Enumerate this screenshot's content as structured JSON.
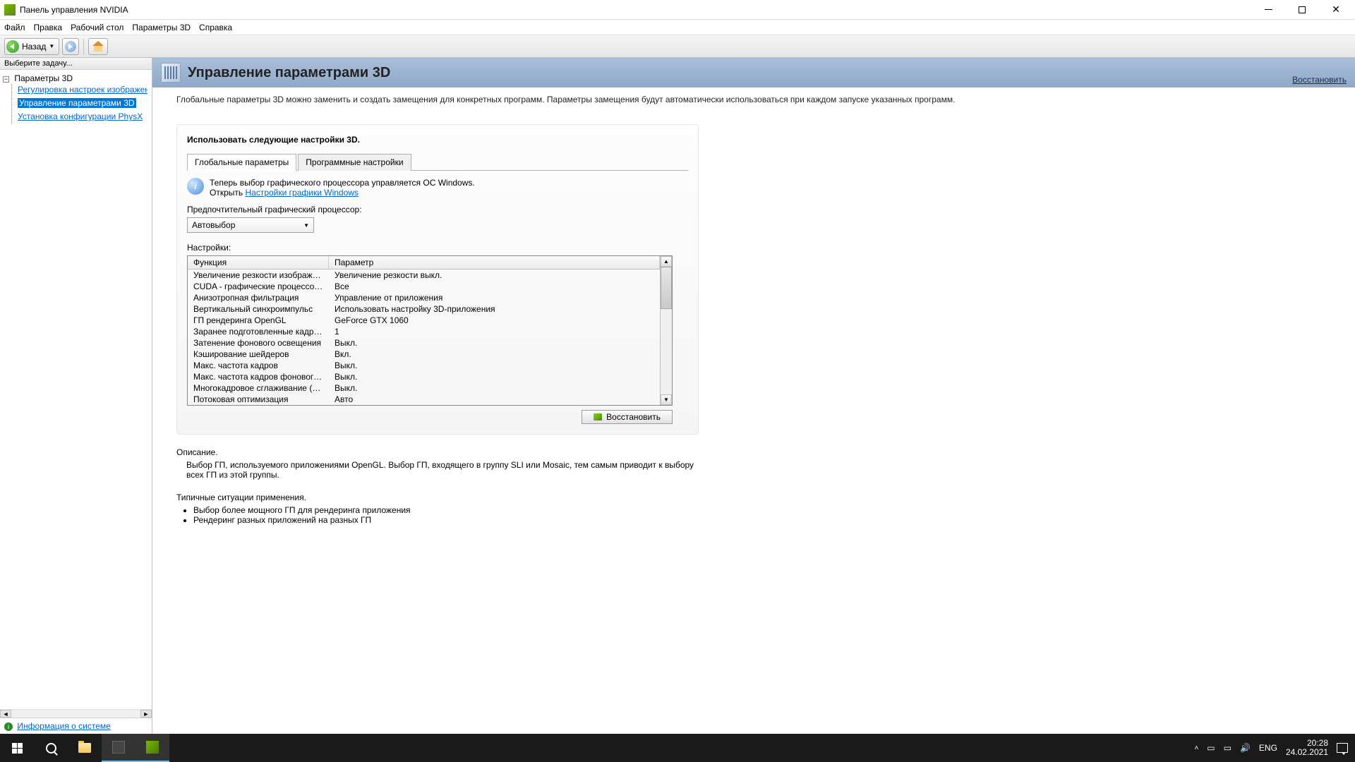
{
  "titlebar": {
    "title": "Панель управления NVIDIA"
  },
  "menu": {
    "file": "Файл",
    "edit": "Правка",
    "desktop": "Рабочий стол",
    "params3d": "Параметры 3D",
    "help": "Справка"
  },
  "nav": {
    "back": "Назад"
  },
  "sidebar": {
    "header": "Выберите задачу...",
    "root": "Параметры 3D",
    "items": [
      "Регулировка настроек изображения с п",
      "Управление параметрами 3D",
      "Установка конфигурации PhysX"
    ],
    "sysinfo": "Информация о системе"
  },
  "page": {
    "title": "Управление параметрами 3D",
    "restore_link": "Восстановить",
    "intro": "Глобальные параметры 3D можно заменить и создать замещения для конкретных программ. Параметры замещения будут автоматически использоваться при каждом запуске указанных программ.",
    "instruction": "Использовать следующие настройки 3D.",
    "tabs": {
      "global": "Глобальные параметры",
      "program": "Программные настройки"
    },
    "info_line1": "Теперь выбор графического процессора управляется ОС Windows.",
    "info_open": "Открыть",
    "info_link": "Настройки графики Windows",
    "pref_gpu_label": "Предпочтительный графический процессор:",
    "pref_gpu_value": "Автовыбор",
    "settings_label": "Настройки:",
    "col_feature": "Функция",
    "col_param": "Параметр",
    "rows": [
      {
        "f": "Увеличение резкости изображения",
        "p": "Увеличение резкости выкл."
      },
      {
        "f": "CUDA - графические процессоры",
        "p": "Все"
      },
      {
        "f": "Анизотропная фильтрация",
        "p": "Управление от приложения"
      },
      {
        "f": "Вертикальный синхроимпульс",
        "p": "Использовать настройку 3D-приложения"
      },
      {
        "f": "ГП рендеринга OpenGL",
        "p": "GeForce GTX 1060"
      },
      {
        "f": "Заранее подготовленные кадры виртуа...",
        "p": "1"
      },
      {
        "f": "Затенение фонового освещения",
        "p": "Выкл."
      },
      {
        "f": "Кэширование шейдеров",
        "p": "Вкл."
      },
      {
        "f": "Макс. частота кадров",
        "p": "Выкл."
      },
      {
        "f": "Макс. частота кадров фонового прилож...",
        "p": "Выкл."
      },
      {
        "f": "Многокадровое сглаживание (MFAA)",
        "p": "Выкл."
      },
      {
        "f": "Потоковая оптимизация",
        "p": "Авто"
      }
    ],
    "restore_btn": "Восстановить",
    "desc_title": "Описание.",
    "desc_body": "Выбор ГП, используемого приложениями OpenGL. Выбор ГП, входящего в группу SLI или Mosaic, тем самым приводит к выбору всех ГП из этой группы.",
    "usage_title": "Типичные ситуации применения.",
    "usage": [
      "Выбор более мощного ГП для рендеринга приложения",
      "Рендеринг разных приложений на разных ГП"
    ]
  },
  "taskbar": {
    "lang": "ENG",
    "time": "20:28",
    "date": "24.02.2021"
  }
}
